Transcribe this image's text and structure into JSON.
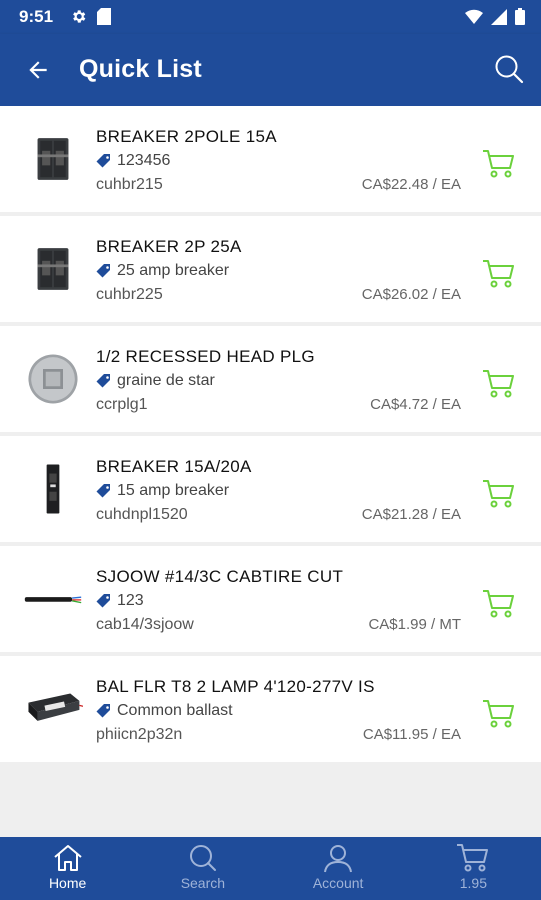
{
  "status_bar": {
    "time": "9:51"
  },
  "app_bar": {
    "title": "Quick List"
  },
  "items": [
    {
      "name": "BREAKER 2POLE 15A",
      "tag": "123456",
      "sku": "cuhbr215",
      "price": "CA$22.48 / EA",
      "thumb": "breaker-2pole"
    },
    {
      "name": "BREAKER 2P 25A",
      "tag": "25 amp breaker",
      "sku": "cuhbr225",
      "price": "CA$26.02 / EA",
      "thumb": "breaker-2pole"
    },
    {
      "name": "1/2 RECESSED HEAD PLG",
      "tag": "graine de star",
      "sku": "ccrplg1",
      "price": "CA$4.72 / EA",
      "thumb": "plug"
    },
    {
      "name": "BREAKER 15A/20A",
      "tag": "15 amp breaker",
      "sku": "cuhdnpl1520",
      "price": "CA$21.28 / EA",
      "thumb": "breaker-slim"
    },
    {
      "name": "SJOOW #14/3C CABTIRE CUT",
      "tag": "123",
      "sku": "cab14/3sjoow",
      "price": "CA$1.99 / MT",
      "thumb": "cable"
    },
    {
      "name": "BAL FLR T8 2 LAMP 4'120-277V IS",
      "tag": "Common ballast",
      "sku": "phiicn2p32n",
      "price": "CA$11.95 / EA",
      "thumb": "ballast"
    }
  ],
  "bottom_nav": {
    "home": "Home",
    "search": "Search",
    "account": "Account",
    "cart": "1.95"
  },
  "colors": {
    "primary": "#1f4c9a",
    "cart_green": "#6bd13c",
    "tag_blue": "#1f4c9a"
  }
}
